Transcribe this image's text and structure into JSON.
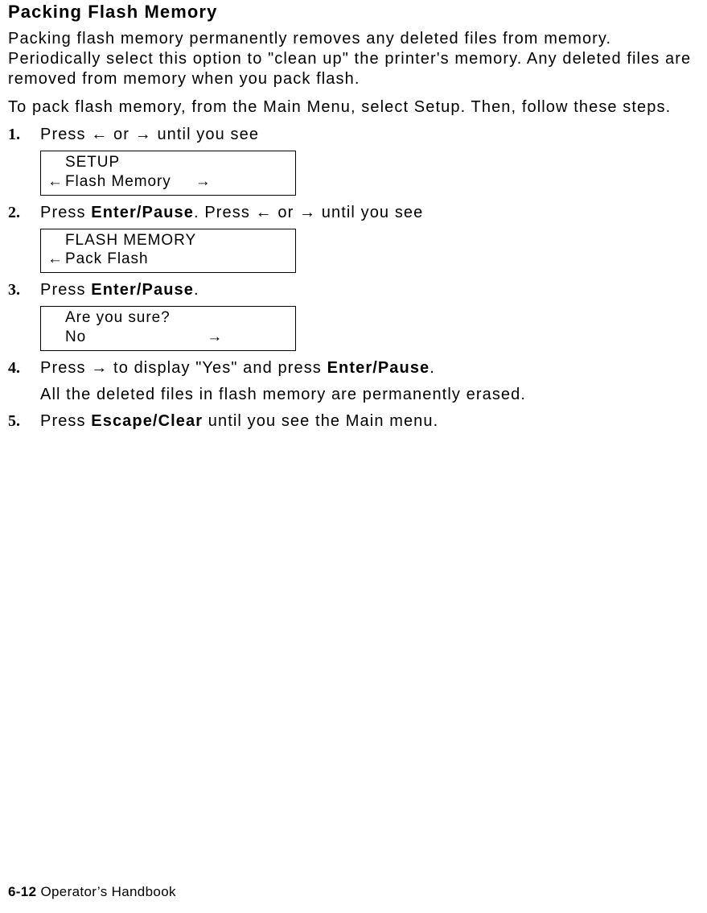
{
  "title": "Packing Flash Memory",
  "intro1": "Packing flash memory permanently removes any deleted files from memory. Periodically select this option to \"clean up\" the printer's memory.  Any deleted files are removed from memory when you pack flash.",
  "intro2": "To pack flash memory, from the Main Menu, select Setup.  Then, follow these steps.",
  "arrows": {
    "left": "←",
    "right": "→"
  },
  "steps": {
    "s1": {
      "pre": "Press ",
      "mid": " or ",
      "post": " until you see"
    },
    "display1": {
      "line1": "SETUP",
      "line2": "Flash Memory"
    },
    "s2": {
      "pre": "Press ",
      "enter": "Enter/Pause",
      "afterEnter": ".  Press ",
      "mid": " or ",
      "post": " until you see"
    },
    "display2": {
      "line1": "FLASH MEMORY",
      "line2": "Pack Flash"
    },
    "s3": {
      "pre": "Press ",
      "enter": "Enter/Pause",
      "post": "."
    },
    "display3": {
      "line1": "Are you sure?",
      "line2": "No"
    },
    "s4": {
      "pre": "Press ",
      "mid": " to display \"Yes\" and press ",
      "enter": "Enter/Pause",
      "post": ".",
      "sub": "All the deleted files in flash memory are permanently erased."
    },
    "s5": {
      "pre": "Press ",
      "escape": "Escape/Clear",
      "post": " until you see the Main menu."
    }
  },
  "footer": {
    "page": "6-12",
    "book": "  Operator’s Handbook"
  }
}
